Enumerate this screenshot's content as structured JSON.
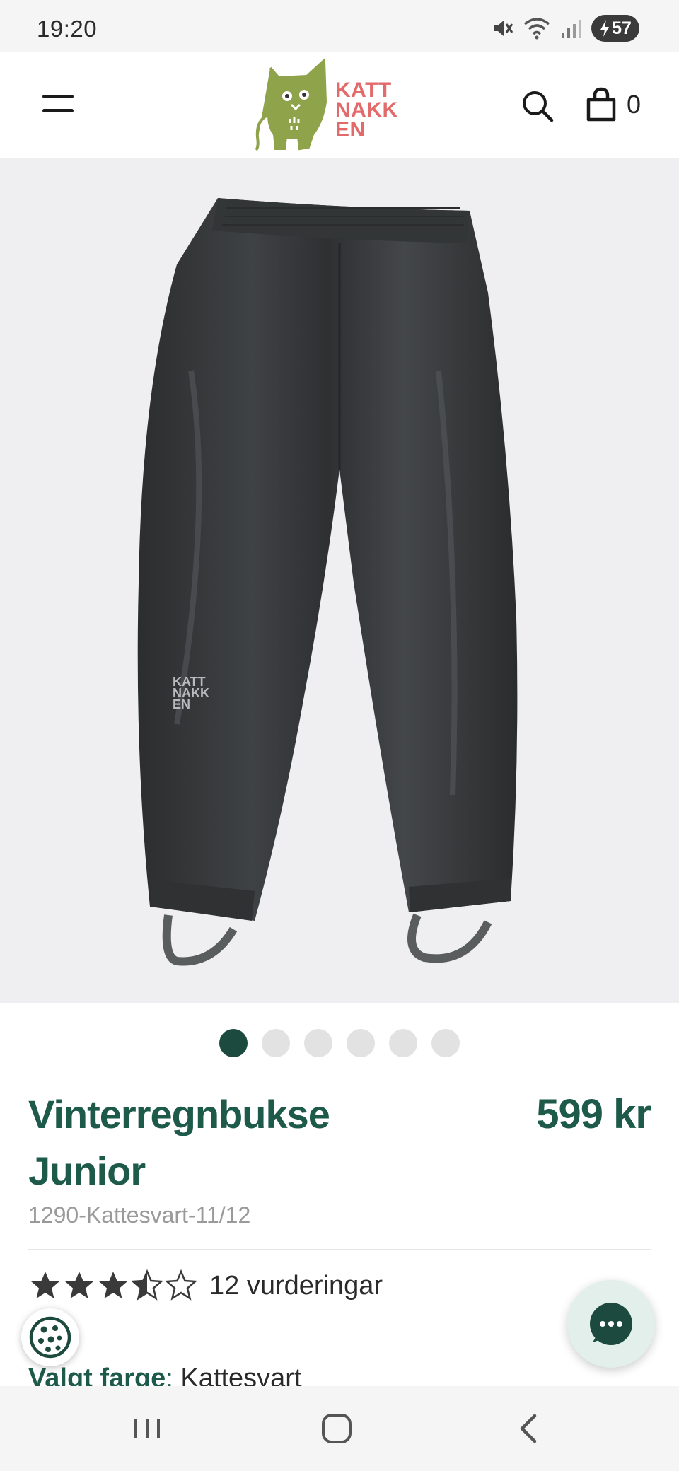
{
  "status_bar": {
    "time": "19:20",
    "battery": "57"
  },
  "header": {
    "logo_text": "KATT NAKK EN",
    "cart_count": "0"
  },
  "product": {
    "image_logo_text": "KATT NAKK EN",
    "title": "Vinterregnbukse Junior",
    "price": "599 kr",
    "sku": "1290-Kattesvart-11/12",
    "rating_value": 3.5,
    "rating_max": 5,
    "rating_text": "12 vurderingar",
    "color_label": "Valgt farge",
    "color_value": "Kattesvart"
  },
  "carousel": {
    "total": 6,
    "active": 0
  },
  "colors": {
    "brand_green": "#1d5a4a",
    "dot_active": "#1d4a3e",
    "logo_green": "#8fa34a",
    "logo_red": "#e26a6a"
  },
  "icons": [
    "menu-icon",
    "search-icon",
    "bag-icon",
    "cookie-icon",
    "chat-icon",
    "recents-icon",
    "home-icon",
    "back-icon"
  ]
}
